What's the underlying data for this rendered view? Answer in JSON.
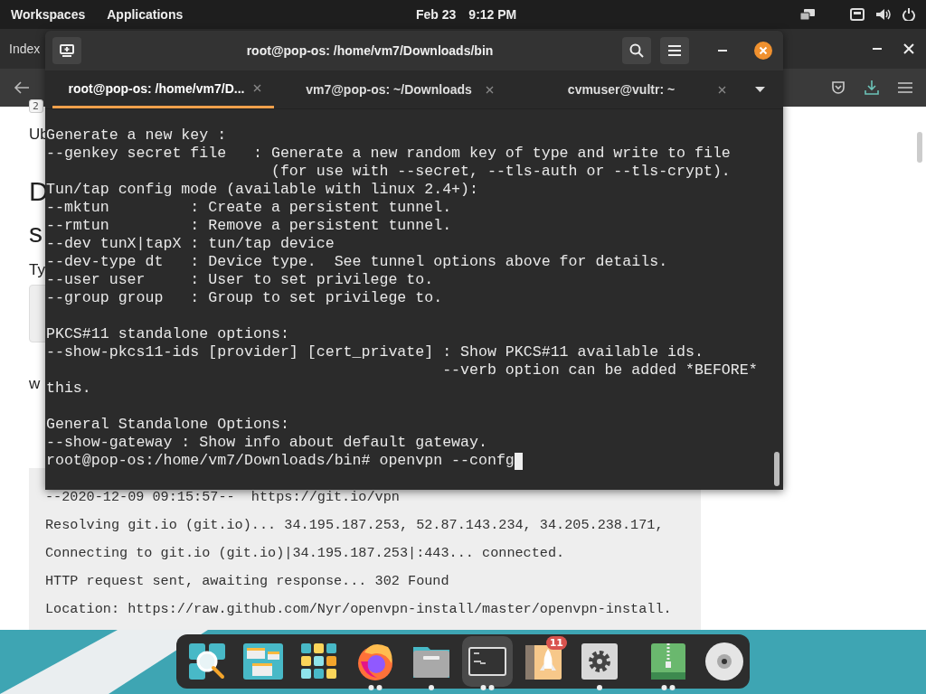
{
  "top_bar": {
    "workspaces": "Workspaces",
    "applications": "Applications",
    "date": "Feb 23",
    "time": "9:12 PM"
  },
  "browser": {
    "title": "Index",
    "tab_fragment": "2",
    "fragments": [
      {
        "kind": "text",
        "text": "Ub"
      },
      {
        "kind": "heading",
        "text": "D"
      },
      {
        "kind": "heading",
        "text": "s"
      },
      {
        "kind": "text",
        "text": "Ty"
      },
      {
        "kind": "box"
      },
      {
        "kind": "text",
        "text": "w"
      }
    ],
    "code_lines": [
      "--2020-12-09 09:15:57--  https://git.io/vpn",
      "Resolving git.io (git.io)... 34.195.187.253, 52.87.143.234, 34.205.238.171,",
      "Connecting to git.io (git.io)|34.195.187.253|:443... connected.",
      "HTTP request sent, awaiting response... 302 Found",
      "Location: https://raw.github.com/Nyr/openvpn-install/master/openvpn-install."
    ]
  },
  "terminal": {
    "title": "root@pop-os: /home/vm7/Downloads/bin",
    "tabs": [
      {
        "label": "root@pop-os: /home/vm7/D...",
        "selected": true
      },
      {
        "label": "vm7@pop-os: ~/Downloads",
        "selected": false
      },
      {
        "label": "cvmuser@vultr: ~",
        "selected": false
      }
    ],
    "blocks": [
      {
        "lines": [
          "Generate a new key :",
          "--genkey secret file   : Generate a new random key of type and write to file",
          "                         (for use with --secret, --tls-auth or --tls-crypt).",
          "Tun/tap config mode (available with linux 2.4+):",
          "--mktun         : Create a persistent tunnel.",
          "--rmtun         : Remove a persistent tunnel.",
          "--dev tunX|tapX : tun/tap device",
          "--dev-type dt   : Device type.  See tunnel options above for details.",
          "--user user     : User to set privilege to.",
          "--group group   : Group to set privilege to."
        ]
      },
      {
        "lines": [
          "PKCS#11 standalone options:",
          "--show-pkcs11-ids [provider] [cert_private] : Show PKCS#11 available ids.",
          "                                            --verb option can be added *BEFORE*",
          "this."
        ]
      },
      {
        "lines": [
          "General Standalone Options:",
          "--show-gateway : Show info about default gateway.",
          "root@pop-os:/home/vm7/Downloads/bin# openvpn --confg"
        ]
      }
    ]
  },
  "dock": {
    "items": [
      {
        "kind": "search",
        "running": false,
        "selected": false
      },
      {
        "kind": "windows",
        "running": false,
        "selected": false
      },
      {
        "kind": "grid",
        "running": false,
        "selected": false
      },
      {
        "kind": "firefox",
        "running": true,
        "several_windows": true,
        "selected": false
      },
      {
        "kind": "cabinet",
        "running": true,
        "several_windows": false,
        "selected": false
      },
      {
        "kind": "terminal",
        "running": true,
        "several_windows": true,
        "selected": true
      },
      {
        "kind": "rocket",
        "running": false,
        "selected": false,
        "badge": "11"
      },
      {
        "kind": "settings",
        "running": true,
        "several_windows": false,
        "selected": false
      },
      {
        "kind": "separator"
      },
      {
        "kind": "archive",
        "running": true,
        "several_windows": true,
        "selected": false
      },
      {
        "kind": "disc",
        "running": false,
        "selected": false
      }
    ]
  }
}
